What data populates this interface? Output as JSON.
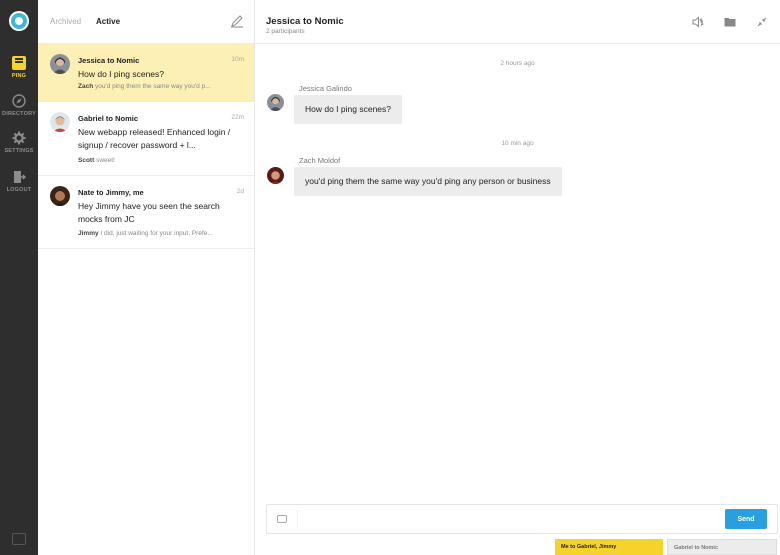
{
  "rail": {
    "items": [
      {
        "label": "PING",
        "icon": "ping-icon",
        "active": true
      },
      {
        "label": "DIRECTORY",
        "icon": "compass-icon"
      },
      {
        "label": "SETTINGS",
        "icon": "gear-icon"
      },
      {
        "label": "LOGOUT",
        "icon": "logout-icon"
      }
    ]
  },
  "convo_list": {
    "tabs": [
      "Archived",
      "Active"
    ],
    "active_tab": "Active",
    "items": [
      {
        "title": "Jessica to Nomic",
        "time": "10m",
        "message": "How do I ping scenes?",
        "preview_author": "Zach",
        "preview_text": "you'd ping them the same way you'd p..."
      },
      {
        "title": "Gabriel to Nomic",
        "time": "22m",
        "message": "New webapp released! Enhanced login / signup / recover password + l...",
        "preview_author": "Scott",
        "preview_text": "sweet!"
      },
      {
        "title": "Nate to Jimmy, me",
        "time": "2d",
        "message": "Hey Jimmy have you seen the search mocks from JC",
        "preview_author": "Jimmy",
        "preview_text": "I did, just waiting for your input. Prefe..."
      }
    ]
  },
  "chat": {
    "title": "Jessica to Nomic",
    "participants": "2 participants",
    "messages": [
      {
        "time": "2 hours ago",
        "author": "Jessica Galindo",
        "text": "How do I ping scenes?"
      },
      {
        "time": "10 min ago",
        "author": "Zach Moldof",
        "text": "you'd ping them the same way you'd ping any person or business"
      }
    ],
    "composer": {
      "placeholder": "",
      "send_label": "Send"
    }
  },
  "bottom_tabs": [
    "Me to Gabriel, Jimmy",
    "Gabriel to Nomic"
  ],
  "colors": {
    "accent_yellow": "#f5d32a",
    "send_blue": "#2a9fe0",
    "rail_bg": "#2e2e2e",
    "selected_row": "#fdf0b4"
  }
}
